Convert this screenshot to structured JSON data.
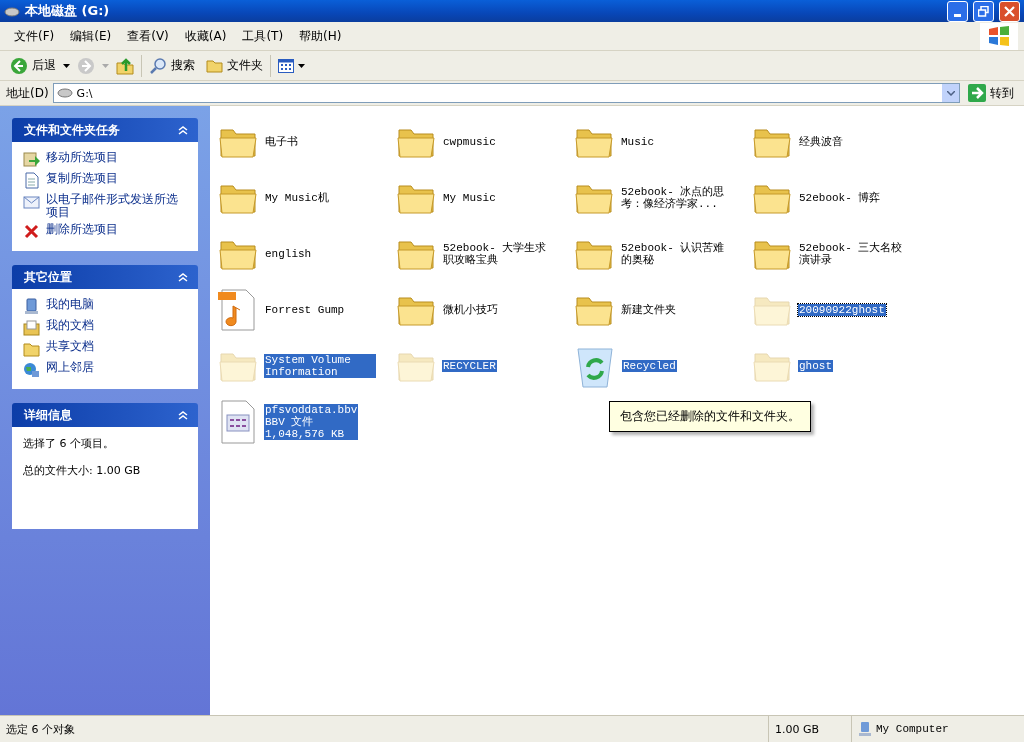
{
  "window": {
    "title": "本地磁盘 (G:)"
  },
  "menu": [
    "文件(F)",
    "编辑(E)",
    "查看(V)",
    "收藏(A)",
    "工具(T)",
    "帮助(H)"
  ],
  "toolbar": {
    "back": "后退",
    "search": "搜索",
    "folders": "文件夹"
  },
  "address": {
    "label": "地址(D)",
    "value": "G:\\",
    "go": "转到"
  },
  "sidebar": [
    {
      "kind": "tasks",
      "title": "文件和文件夹任务",
      "expanded": true,
      "items": [
        {
          "label": "移动所选项目"
        },
        {
          "label": "复制所选项目"
        },
        {
          "label": "以电子邮件形式发送所选项目"
        },
        {
          "label": "删除所选项目"
        }
      ]
    },
    {
      "kind": "places",
      "title": "其它位置",
      "expanded": true,
      "items": [
        {
          "label": "我的电脑"
        },
        {
          "label": "我的文档"
        },
        {
          "label": "共享文档"
        },
        {
          "label": "网上邻居"
        }
      ]
    },
    {
      "kind": "details",
      "title": "详细信息",
      "expanded": true,
      "lines": [
        "选择了 6 个项目。",
        "总的文件大小: 1.00 GB"
      ]
    }
  ],
  "items": [
    {
      "kind": "folder",
      "name": "电子书",
      "hidden": false,
      "selected": false,
      "focused": false
    },
    {
      "kind": "folder",
      "name": "cwpmusic",
      "hidden": false,
      "selected": false,
      "focused": false
    },
    {
      "kind": "folder",
      "name": "Music",
      "hidden": false,
      "selected": false,
      "focused": false
    },
    {
      "kind": "folder",
      "name": "经典波音",
      "hidden": false,
      "selected": false,
      "focused": false
    },
    {
      "kind": "folder",
      "name": "My Music机",
      "hidden": false,
      "selected": false,
      "focused": false
    },
    {
      "kind": "folder",
      "name": "My Music",
      "hidden": false,
      "selected": false,
      "focused": false
    },
    {
      "kind": "folder",
      "name": "52ebook- 冰点的思考：像经济学家...",
      "hidden": false,
      "selected": false,
      "focused": false
    },
    {
      "kind": "folder",
      "name": "52ebook- 博弈",
      "hidden": false,
      "selected": false,
      "focused": false
    },
    {
      "kind": "folder",
      "name": "english",
      "hidden": false,
      "selected": false,
      "focused": false
    },
    {
      "kind": "folder",
      "name": "52ebook- 大学生求职攻略宝典",
      "hidden": false,
      "selected": false,
      "focused": false
    },
    {
      "kind": "folder",
      "name": "52ebook- 认识苦难的奥秘",
      "hidden": false,
      "selected": false,
      "focused": false
    },
    {
      "kind": "folder",
      "name": "52ebook- 三大名校演讲录",
      "hidden": false,
      "selected": false,
      "focused": false
    },
    {
      "kind": "mp3",
      "name": "Forrest Gump",
      "hidden": false,
      "selected": false,
      "focused": false
    },
    {
      "kind": "folder",
      "name": "微机小技巧",
      "hidden": false,
      "selected": false,
      "focused": false
    },
    {
      "kind": "folder",
      "name": "新建文件夹",
      "hidden": false,
      "selected": false,
      "focused": false
    },
    {
      "kind": "folder",
      "name": "20090922ghost",
      "hidden": true,
      "selected": true,
      "focused": true
    },
    {
      "kind": "folder",
      "name": "System Volume Information",
      "hidden": true,
      "selected": true,
      "focused": false
    },
    {
      "kind": "folder",
      "name": "RECYCLER",
      "hidden": true,
      "selected": true,
      "focused": false
    },
    {
      "kind": "recycle",
      "name": "Recycled",
      "hidden": false,
      "selected": true,
      "focused": false
    },
    {
      "kind": "folder",
      "name": "ghost",
      "hidden": true,
      "selected": true,
      "focused": false
    },
    {
      "kind": "file",
      "name": "pfsvoddata.bbv",
      "details": [
        "BBV 文件",
        "1,048,576 KB"
      ],
      "hidden": false,
      "selected": true,
      "focused": false
    }
  ],
  "tooltip": {
    "text": "包含您已经删除的文件和文件夹。"
  },
  "status_bar": {
    "selection": "选定 6 个对象",
    "size": "1.00 GB",
    "zone": "My Computer"
  }
}
